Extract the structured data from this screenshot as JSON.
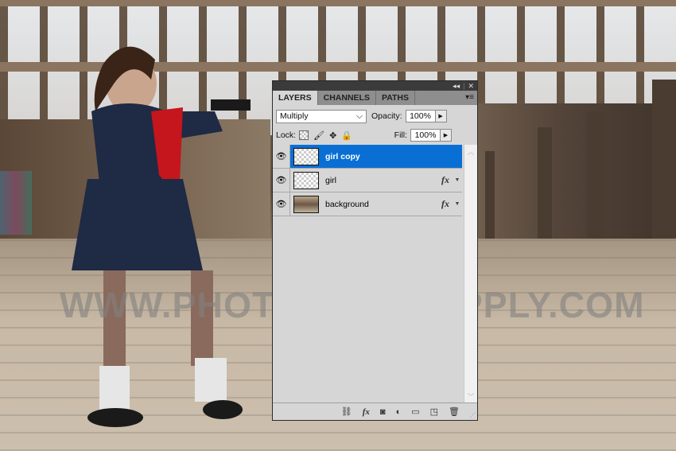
{
  "watermark": "WWW.PHOTOSHOPSUPPLY.COM",
  "panel": {
    "header_buttons": {
      "collapse": "◂◂",
      "close": "✕"
    },
    "tabs": [
      {
        "label": "LAYERS",
        "active": true
      },
      {
        "label": "CHANNELS",
        "active": false
      },
      {
        "label": "PATHS",
        "active": false
      }
    ],
    "menu_icon": "panel-menu-icon",
    "blend_mode": {
      "value": "Multiply",
      "chevron": "⌵"
    },
    "opacity": {
      "label": "Opacity:",
      "value": "100%"
    },
    "lock": {
      "label": "Lock:"
    },
    "fill": {
      "label": "Fill:",
      "value": "100%"
    },
    "layers": [
      {
        "name": "girl copy",
        "visible": true,
        "selected": true,
        "has_fx": false
      },
      {
        "name": "girl",
        "visible": true,
        "selected": false,
        "has_fx": true
      },
      {
        "name": "background",
        "visible": true,
        "selected": false,
        "has_fx": true
      }
    ],
    "fx_label": "fx",
    "bottom_icons": [
      "link-layers-icon",
      "add-layer-style-icon",
      "add-mask-icon",
      "adjustment-layer-icon",
      "new-group-icon",
      "new-layer-icon",
      "delete-layer-icon"
    ],
    "selection_color": "#0a6fd4"
  }
}
